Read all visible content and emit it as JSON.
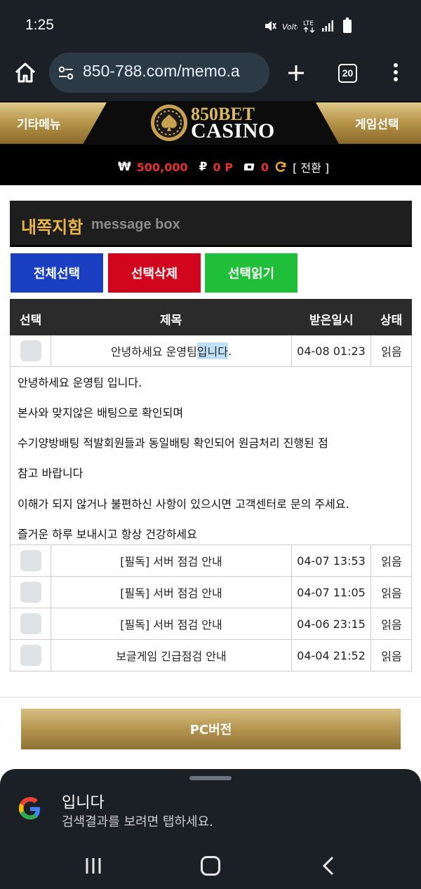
{
  "status_bar": {
    "time": "1:25",
    "network": "LTE"
  },
  "browser": {
    "url": "850-788.com/memo.a",
    "tab_count": "20"
  },
  "site_header": {
    "left_menu": "기타메뉴",
    "right_menu": "게임선택",
    "logo_top": "850BET",
    "logo_bottom": "CASINO"
  },
  "balance": {
    "won_symbol": "₩",
    "money": "500,000",
    "point_symbol": "₽",
    "points": "0 P",
    "chips": "0",
    "convert_label": "[ 전환 ]"
  },
  "message_box": {
    "title": "내쪽지함",
    "subtitle": "message box"
  },
  "actions": {
    "select_all": "전체선택",
    "delete_selected": "선택삭제",
    "read_selected": "선택읽기"
  },
  "table": {
    "headers": [
      "선택",
      "제목",
      "받은일시",
      "상태"
    ],
    "rows": [
      {
        "title_pre": "안녕하세요 운영팀 ",
        "title_hl": "입니다",
        "title_post": ".",
        "date": "04-08 01:23",
        "status": "읽음"
      },
      {
        "title": "[필독] 서버 점검 안내",
        "date": "04-07 13:53",
        "status": "읽음"
      },
      {
        "title": "[필독] 서버 점검 안내",
        "date": "04-07 11:05",
        "status": "읽음"
      },
      {
        "title": "[필독] 서버 점검 안내",
        "date": "04-06 23:15",
        "status": "읽음"
      },
      {
        "title": "보글게임 긴급점검 안내",
        "date": "04-04 21:52",
        "status": "읽음"
      }
    ],
    "expanded_body": [
      "안녕하세요 운영팀 입니다.",
      "본사와 맞지않은 배팅으로 확인되며",
      "수기양방배팅 적발회원들과 동일배팅 확인되어 원금처리 진행된 점",
      "참고 바랍니다",
      "이해가 되지 않거나 불편하신 사항이 있으시면 고객센터로 문의 주세요.",
      "즐거운 하루 보내시고 항상 건강하세요"
    ]
  },
  "pc_button": "PC버전",
  "search_sheet": {
    "query": "입니다",
    "hint": "검색결과를 보려면 탭하세요."
  },
  "colors": {
    "gold": "#b8974c",
    "blue_button": "#1a3fc1",
    "red_button": "#d1061e",
    "green_button": "#1fbf3a",
    "balance_red": "#e63329"
  }
}
